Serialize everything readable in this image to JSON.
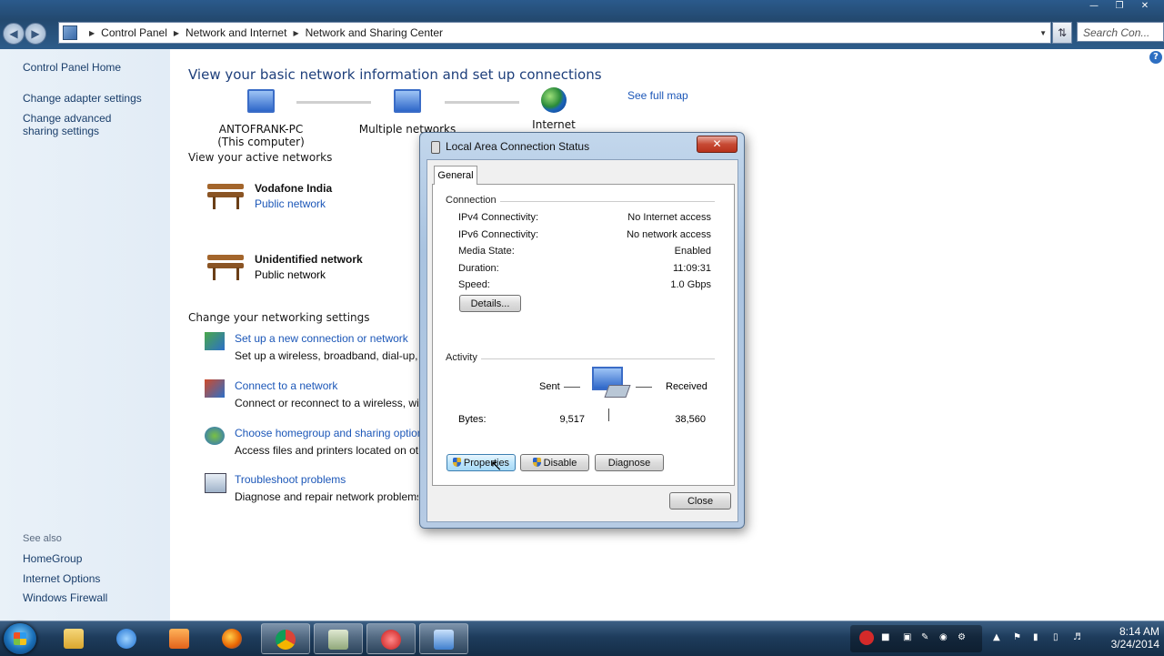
{
  "window": {
    "breadcrumb": [
      "Control Panel",
      "Network and Internet",
      "Network and Sharing Center"
    ],
    "search_placeholder": "Search Con..."
  },
  "sidebar": {
    "home": "Control Panel Home",
    "items": [
      "Change adapter settings",
      "Change advanced sharing settings"
    ],
    "see_also_label": "See also",
    "see_also": [
      "HomeGroup",
      "Internet Options",
      "Windows Firewall"
    ]
  },
  "main": {
    "title": "View your basic network information and set up connections",
    "see_full_map": "See full map",
    "map": {
      "computer_name": "ANTOFRANK-PC",
      "computer_sub": "(This computer)",
      "middle": "Multiple networks",
      "internet": "Internet"
    },
    "active_networks_label": "View your active networks",
    "networks": [
      {
        "name": "Vodafone India",
        "type": "Public network",
        "type_is_link": true
      },
      {
        "name": "Unidentified network",
        "type": "Public network",
        "type_is_link": false
      }
    ],
    "change_settings_label": "Change your networking settings",
    "tasks": [
      {
        "title": "Set up a new connection or network",
        "desc": "Set up a wireless, broadband, dial-up, ad"
      },
      {
        "title": "Connect to a network",
        "desc": "Connect or reconnect to a wireless, wired"
      },
      {
        "title": "Choose homegroup and sharing options",
        "desc": "Access files and printers located on other"
      },
      {
        "title": "Troubleshoot problems",
        "desc": "Diagnose and repair network problems, o"
      }
    ]
  },
  "dialog": {
    "title": "Local Area Connection Status",
    "close_x": "✕",
    "tab": "General",
    "connection_label": "Connection",
    "rows": [
      {
        "key": "IPv4 Connectivity:",
        "value": "No Internet access"
      },
      {
        "key": "IPv6 Connectivity:",
        "value": "No network access"
      },
      {
        "key": "Media State:",
        "value": "Enabled"
      },
      {
        "key": "Duration:",
        "value": "11:09:31"
      },
      {
        "key": "Speed:",
        "value": "1.0 Gbps"
      }
    ],
    "details_button": "Details...",
    "activity_label": "Activity",
    "sent_label": "Sent",
    "received_label": "Received",
    "bytes_label": "Bytes:",
    "bytes_sent": "9,517",
    "bytes_received": "38,560",
    "properties_button": "Properties",
    "disable_button": "Disable",
    "diagnose_button": "Diagnose",
    "close_button": "Close"
  },
  "taskbar": {
    "time": "8:14 AM",
    "date": "3/24/2014"
  }
}
